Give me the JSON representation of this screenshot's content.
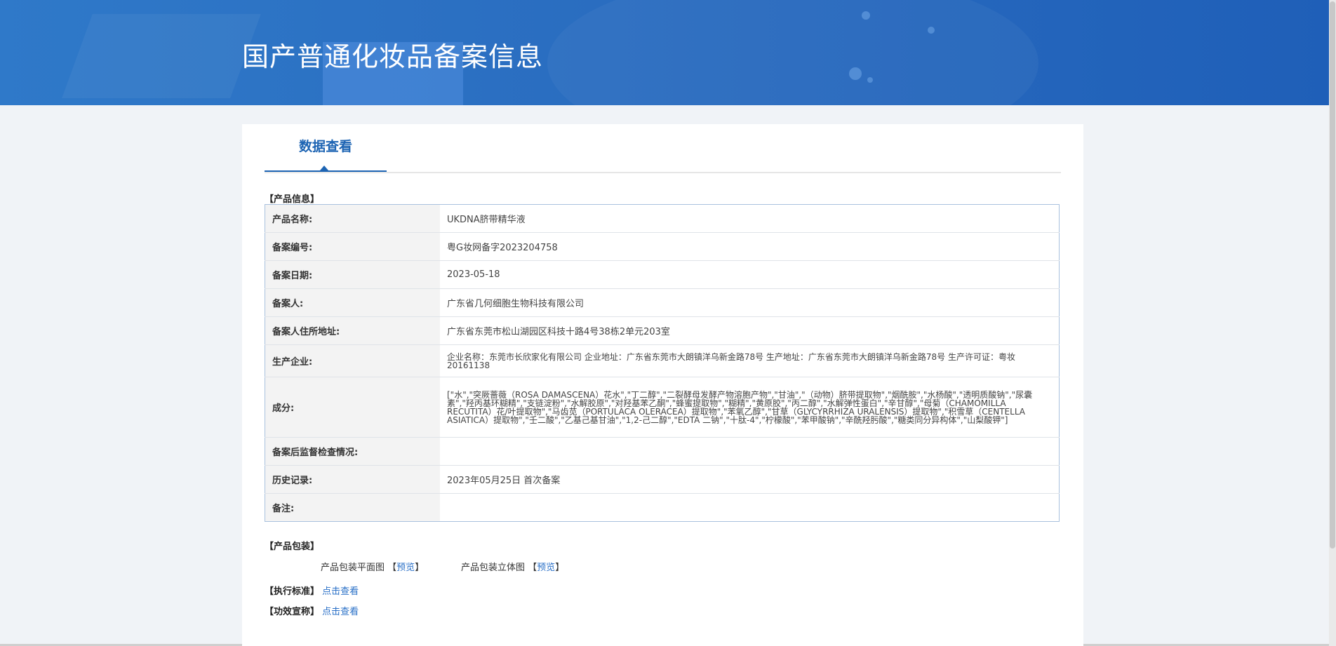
{
  "header": {
    "title": "国产普通化妆品备案信息"
  },
  "tabs": [
    {
      "label": "数据查看"
    }
  ],
  "product_info": {
    "section_label": "【产品信息】",
    "rows": [
      {
        "key": "产品名称:",
        "value": "UKDNA脐带精华液"
      },
      {
        "key": "备案编号:",
        "value": "粤G妆网备字2023204758"
      },
      {
        "key": "备案日期:",
        "value": "2023-05-18"
      },
      {
        "key": "备案人:",
        "value": "广东省几何细胞生物科技有限公司"
      },
      {
        "key": "备案人住所地址:",
        "value": "广东省东莞市松山湖园区科技十路4号38栋2单元203室"
      },
      {
        "key": "生产企业:",
        "value": "企业名称：东莞市长欣家化有限公司 企业地址：广东省东莞市大朗镇洋乌新金路78号 生产地址：广东省东莞市大朗镇洋乌新金路78号 生产许可证：粤妆20161138"
      },
      {
        "key": "成分:",
        "value": "[\"水\",\"突厥蔷薇（ROSA DAMASCENA）花水\",\"丁二醇\",\"二裂酵母发酵产物溶胞产物\",\"甘油\",\"（动物）脐带提取物\",\"烟酰胺\",\"水杨酸\",\"透明质酸钠\",\"尿囊素\",\"羟丙基环糊精\",\"支链淀粉\",\"水解胶原\",\"对羟基苯乙酮\",\"蜂蜜提取物\",\"糊精\",\"黄原胶\",\"丙二醇\",\"水解弹性蛋白\",\"辛甘醇\",\"母菊（CHAMOMILLA RECUTITA）花/叶提取物\",\"马齿苋（PORTULACA OLERACEA）提取物\",\"苯氧乙醇\",\"甘草（GLYCYRRHIZA URALENSIS）提取物\",\"积雪草（CENTELLA ASIATICA）提取物\",\"壬二酸\",\"乙基己基甘油\",\"1,2-己二醇\",\"EDTA 二钠\",\"十肽-4\",\"柠檬酸\",\"苯甲酸钠\",\"辛酰羟肟酸\",\"糖类同分异构体\",\"山梨酸钾\"]"
      },
      {
        "key": "备案后监督检查情况:",
        "value": ""
      },
      {
        "key": "历史记录:",
        "value": "2023年05月25日 首次备案"
      },
      {
        "key": "备注:",
        "value": ""
      }
    ]
  },
  "packaging": {
    "section_label": "【产品包装】",
    "flat_label": "产品包装平面图",
    "stereo_label": "产品包装立体图",
    "bracket_open": "【",
    "bracket_close": "】",
    "preview_label": "预览"
  },
  "standard": {
    "label": "【执行标准】",
    "link": "点击查看"
  },
  "efficacy": {
    "label": "【功效宣称】",
    "link": "点击查看"
  }
}
